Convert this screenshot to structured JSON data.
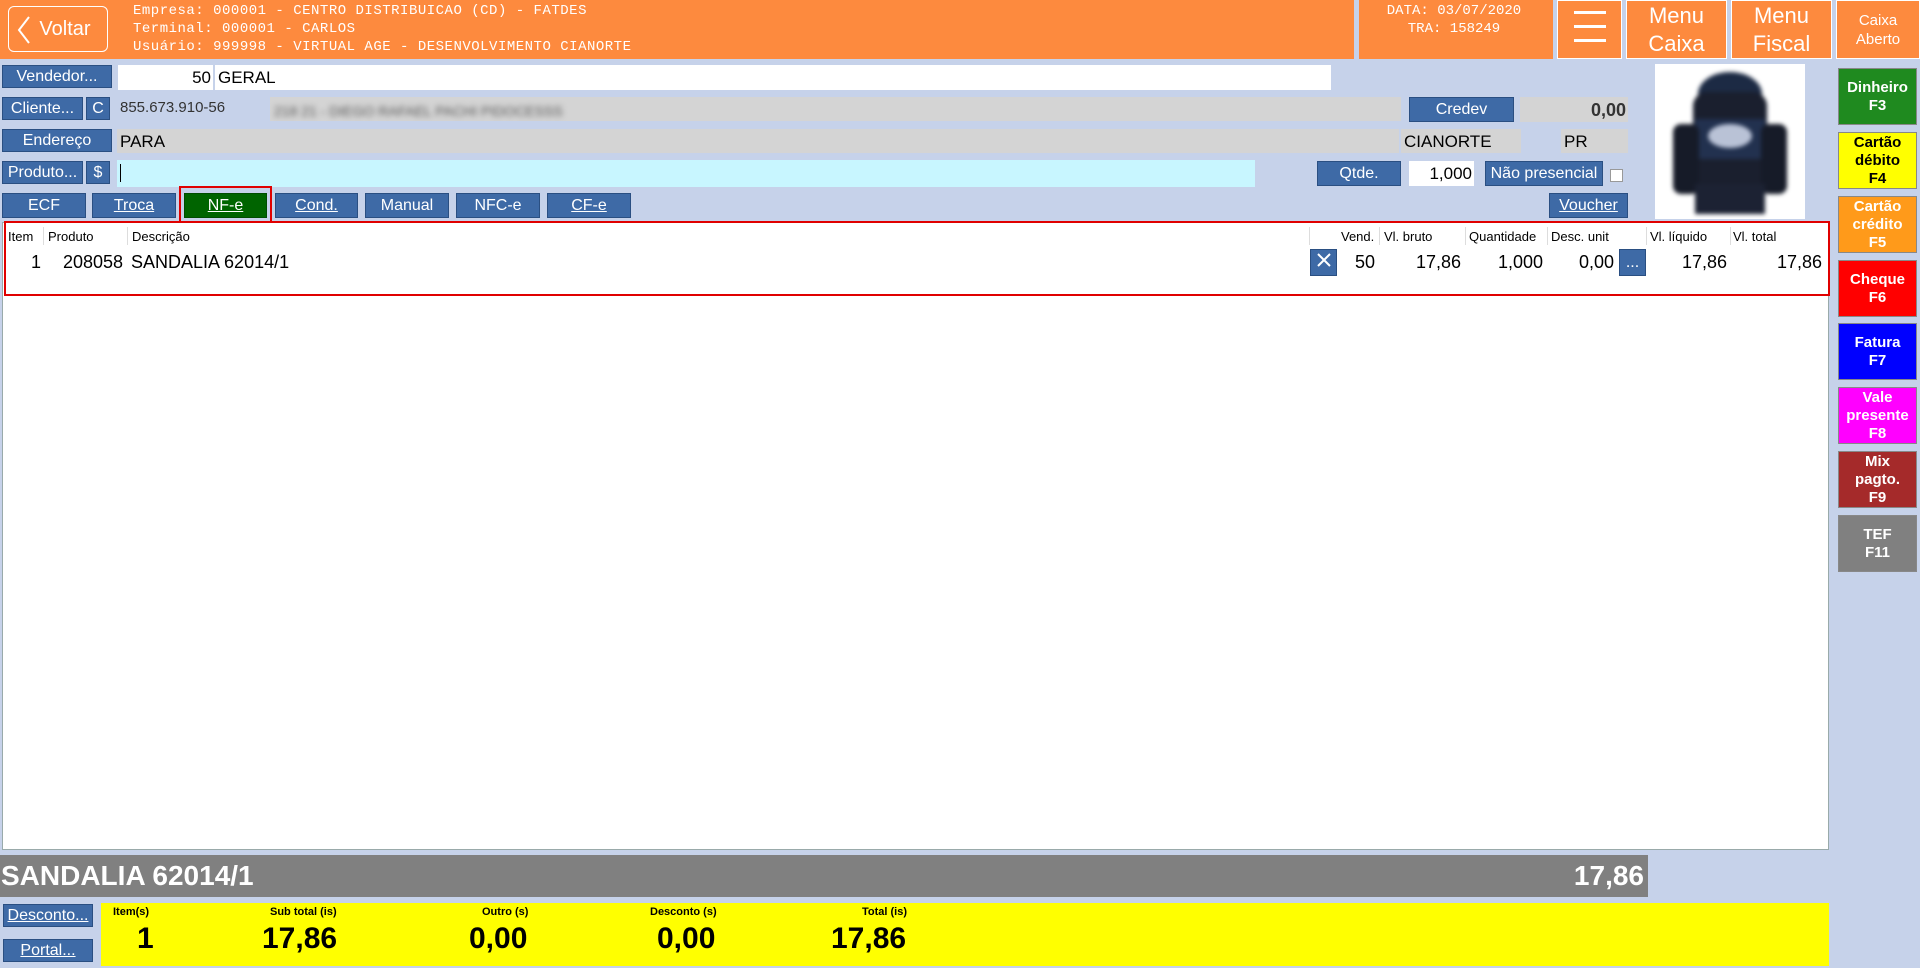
{
  "header": {
    "back_label": "Voltar",
    "empresa": "Empresa: 000001 - CENTRO DISTRIBUICAO (CD) - FATDES",
    "terminal": "Terminal: 000001 - CARLOS",
    "usuario": "Usuário: 999998 - VIRTUAL AGE - DESENVOLVIMENTO CIANORTE",
    "data": "DATA: 03/07/2020",
    "tra": "TRA: 158249",
    "menu_caixa_1": "Menu",
    "menu_caixa_2": "Caixa",
    "menu_fiscal_1": "Menu",
    "menu_fiscal_2": "Fiscal",
    "caixa_status_1": "Caixa",
    "caixa_status_2": "Aberto"
  },
  "form": {
    "vendedor_label": "Vendedor...",
    "vendedor_code": "50",
    "vendedor_name": "GERAL",
    "cliente_label": "Cliente...",
    "cliente_c": "C",
    "cliente_doc": "855.673.910-56",
    "cliente_name": "218 21 - DIEGO RAFAEL PACHI PIDOCESSS",
    "credev_label": "Credev",
    "credev_value": "0,00",
    "endereco_label": "Endereço",
    "endereco": "PARA",
    "cidade": "CIANORTE",
    "uf": "PR",
    "produto_label": "Produto...",
    "produto_dollar": "$",
    "produto_value": "",
    "qtde_label": "Qtde.",
    "qtde_value": "1,000",
    "nao_presencial_label": "Não presencial",
    "voucher_label": "Voucher"
  },
  "doc_types": {
    "ecf": "ECF",
    "troca": "Troca",
    "nfe": "NF-e",
    "cond": "Cond.",
    "manual": "Manual",
    "nfce": "NFC-e",
    "cfe": "CF-e"
  },
  "table": {
    "headers": [
      "Item",
      "Produto",
      "Descrição",
      "Vend.",
      "Vl. bruto",
      "Quantidade",
      "Desc. unit",
      "Vl. líquido",
      "Vl. total"
    ],
    "rows": [
      {
        "item": "1",
        "produto": "208058",
        "descricao": "SANDALIA 62014/1",
        "vend": "50",
        "vl_bruto": "17,86",
        "quantidade": "1,000",
        "desc_unit": "0,00",
        "more": "...",
        "vl_liquido": "17,86",
        "vl_total": "17,86"
      }
    ]
  },
  "selected": {
    "name": "SANDALIA 62014/1",
    "value": "17,86"
  },
  "footer": {
    "desconto_label": "Desconto...",
    "portal_label": "Portal...",
    "itens_label": "Item(s)",
    "itens_value": "1",
    "subtotal_label": "Sub total (is)",
    "subtotal_value": "17,86",
    "outro_label": "Outro (s)",
    "outro_value": "0,00",
    "desconto_tot_label": "Desconto (s)",
    "desconto_tot_value": "0,00",
    "total_label": "Total (is)",
    "total_value": "17,86"
  },
  "payments": [
    {
      "l1": "Dinheiro",
      "l2": "F3",
      "bg": "#1f8a1f",
      "fg": "#ffffff"
    },
    {
      "l1": "Cartão",
      "l2": "débito",
      "l3": "F4",
      "bg": "#ffff00",
      "fg": "#000000"
    },
    {
      "l1": "Cartão",
      "l2": "crédito",
      "l3": "F5",
      "bg": "#ff9a1a",
      "fg": "#ffffff"
    },
    {
      "l1": "Cheque",
      "l2": "F6",
      "bg": "#ff0000",
      "fg": "#ffffff"
    },
    {
      "l1": "Fatura",
      "l2": "F7",
      "bg": "#0000ff",
      "fg": "#ffffff"
    },
    {
      "l1": "Vale",
      "l2": "presente",
      "l3": "F8",
      "bg": "#ff00ff",
      "fg": "#ffffff"
    },
    {
      "l1": "Mix",
      "l2": "pagto.",
      "l3": "F9",
      "bg": "#a52a2a",
      "fg": "#ffffff"
    },
    {
      "l1": "TEF",
      "l2": "F11",
      "bg": "#808080",
      "fg": "#ffffff"
    }
  ],
  "colors": {
    "header": "#fd8a3e",
    "button_blue": "#3e6aa6",
    "nfe_active": "#006400",
    "highlight_red": "#e00000",
    "totals_yellow": "#ffff00",
    "status_gray": "#808080"
  }
}
